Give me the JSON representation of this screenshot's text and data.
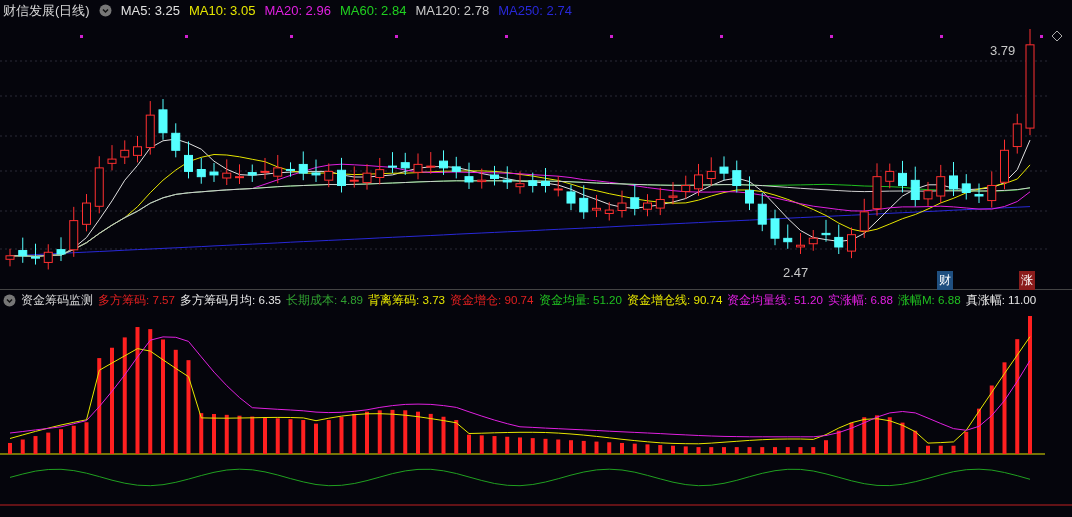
{
  "price_panel": {
    "title": "财信发展(日线)",
    "indicators": [
      {
        "label": "MA5: 3.25",
        "color": "#e0e0e0"
      },
      {
        "label": "MA10: 3.05",
        "color": "#e6e600"
      },
      {
        "label": "MA20: 2.96",
        "color": "#e020e0"
      },
      {
        "label": "MA60: 2.84",
        "color": "#20d020"
      },
      {
        "label": "MA120: 2.78",
        "color": "#c8c8c8"
      },
      {
        "label": "MA250: 2.74",
        "color": "#2828d8"
      }
    ],
    "high_label": "3.79",
    "low_label": "2.47",
    "badges": [
      {
        "text": "财",
        "color": "#1f4f80"
      },
      {
        "text": "涨",
        "color": "#8a1c1c"
      }
    ]
  },
  "indicator_panel": {
    "title": "资金筹码监测",
    "indicators": [
      {
        "label": "多方筹码: 7.57",
        "color": "#e02020"
      },
      {
        "label": "多方筹码月均: 6.35",
        "color": "#e8e8e8"
      },
      {
        "label": "长期成本: 4.89",
        "color": "#30a030"
      },
      {
        "label": "背离筹码: 3.73",
        "color": "#e6e600"
      },
      {
        "label": "资金增仓: 90.74",
        "color": "#e02020"
      },
      {
        "label": "资金均量: 51.20",
        "color": "#20c020"
      },
      {
        "label": "资金增仓线: 90.74",
        "color": "#e6e600"
      },
      {
        "label": "资金均量线: 51.20",
        "color": "#e020e0"
      },
      {
        "label": "实涨幅: 6.88",
        "color": "#e020e0"
      },
      {
        "label": "涨幅M: 6.88",
        "color": "#20c020"
      },
      {
        "label": "真涨幅: 11.00",
        "color": "#e8e8e8"
      }
    ]
  }
}
